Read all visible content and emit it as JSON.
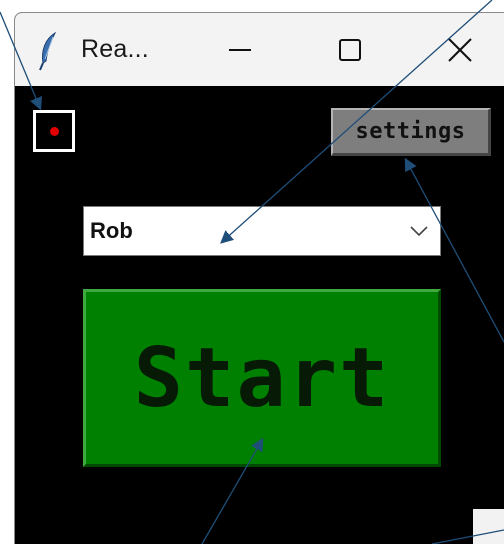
{
  "window": {
    "title": "Rea..."
  },
  "titlebar_buttons": {
    "minimize_icon": "minimize-icon",
    "maximize_icon": "maximize-icon",
    "close_icon": "close-icon"
  },
  "indicator": {
    "dot_color": "#e00000"
  },
  "settings_button": {
    "label": "settings"
  },
  "name_combo": {
    "selected_value": "Rob",
    "icon": "chevron-down-icon"
  },
  "start_button": {
    "label": "Start",
    "color": "#008000"
  },
  "annotation_color": "#1f4e79"
}
